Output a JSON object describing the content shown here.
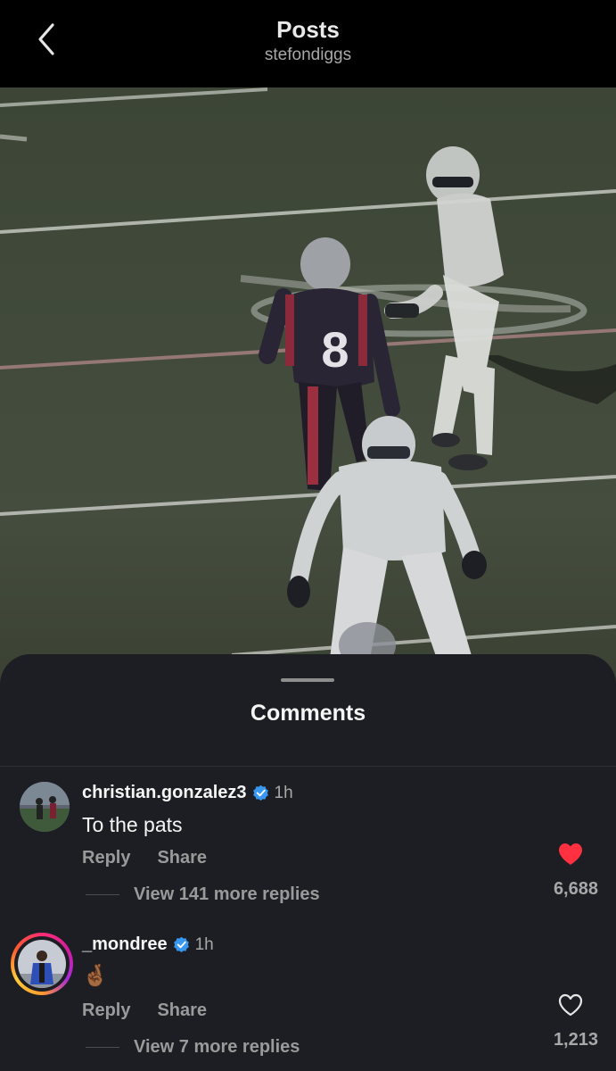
{
  "header": {
    "title": "Posts",
    "username": "stefondiggs"
  },
  "video": {
    "jersey_number": "8"
  },
  "comments_sheet": {
    "title": "Comments",
    "comments": [
      {
        "username": "christian.gonzalez3",
        "verified": true,
        "time": "1h",
        "text": "To the pats",
        "reply_label": "Reply",
        "share_label": "Share",
        "liked": true,
        "like_count": "6,688",
        "view_replies": "View 141 more replies"
      },
      {
        "username": "_mondree",
        "verified": true,
        "time": "1h",
        "text": "🤞🏾",
        "reply_label": "Reply",
        "share_label": "Share",
        "liked": false,
        "like_count": "1,213",
        "view_replies": "View 7 more replies"
      }
    ]
  },
  "colors": {
    "sheet_bg": "#1c1e23",
    "like_red": "#ff3040",
    "verified_blue": "#3897f0"
  }
}
